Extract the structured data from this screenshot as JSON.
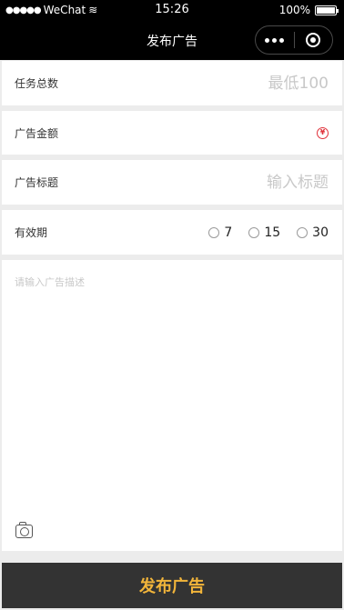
{
  "status_bar": {
    "signal": "●●●●●",
    "carrier": "WeChat",
    "wifi": "≋",
    "time": "15:26",
    "battery_percent": "100%",
    "battery_level": 1.0
  },
  "nav": {
    "title": "发布广告"
  },
  "form": {
    "task_total": {
      "label": "任务总数",
      "placeholder": "最低100",
      "value": ""
    },
    "ad_amount": {
      "label": "广告金额",
      "coin_symbol": "¥"
    },
    "ad_title": {
      "label": "广告标题",
      "placeholder": "输入标题",
      "value": ""
    },
    "validity": {
      "label": "有效期",
      "options": [
        "7",
        "15",
        "30"
      ],
      "selected": null
    },
    "description": {
      "placeholder": "请输入广告描述",
      "value": ""
    }
  },
  "submit_label": "发布广告",
  "colors": {
    "accent": "#f2b53a",
    "coin": "#e0313a",
    "header_bg": "#000000",
    "submit_bg": "#333333"
  }
}
